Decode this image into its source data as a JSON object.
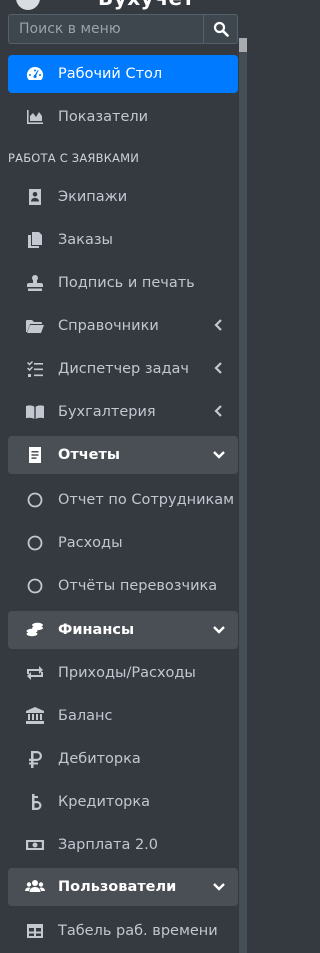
{
  "brand": {
    "title": "Бухучет"
  },
  "search": {
    "placeholder": "Поиск в меню"
  },
  "header": {
    "section_label": "РАБОТА С ЗАЯВКАМИ"
  },
  "nav": {
    "dashboard": {
      "label": "Рабочий Стол",
      "icon": "tachometer-icon"
    },
    "indicators": {
      "label": "Показатели",
      "icon": "area-chart-icon"
    },
    "crews": {
      "label": "Экипажи",
      "icon": "id-badge-icon"
    },
    "orders": {
      "label": "Заказы",
      "icon": "copy-icon"
    },
    "signature": {
      "label": "Подпись и печать",
      "icon": "stamp-icon"
    },
    "references": {
      "label": "Справочники",
      "icon": "folder-open-icon"
    },
    "tasks": {
      "label": "Диспетчер задач",
      "icon": "tasks-icon"
    },
    "accounting": {
      "label": "Бухгалтерия",
      "icon": "book-open-icon"
    },
    "reports": {
      "label": "Отчеты",
      "icon": "file-alt-icon"
    },
    "report_staff": {
      "label": "Отчет по Сотрудникам",
      "icon": "circle-outline-icon"
    },
    "report_expenses": {
      "label": "Расходы",
      "icon": "circle-outline-icon"
    },
    "report_carrier": {
      "label": "Отчёты перевозчика",
      "icon": "circle-outline-icon"
    },
    "finances": {
      "label": "Финансы",
      "icon": "coins-icon"
    },
    "income_expense": {
      "label": "Приходы/Расходы",
      "icon": "exchange-icon"
    },
    "balance": {
      "label": "Баланс",
      "icon": "bank-icon"
    },
    "receivables": {
      "label": "Дебиторка",
      "icon": "ruble-icon"
    },
    "payables": {
      "label": "Кредиторка",
      "icon": "b-currency-icon"
    },
    "salary": {
      "label": "Зарплата 2.0",
      "icon": "money-bill-icon"
    },
    "users": {
      "label": "Пользователи",
      "icon": "users-icon"
    },
    "timesheet": {
      "label": "Табель раб. времени",
      "icon": "table-icon"
    }
  },
  "colors": {
    "sidebar_bg": "#343a40",
    "active_bg": "#007bff",
    "open_bg": "#494f55",
    "text": "#c2c7d0"
  }
}
